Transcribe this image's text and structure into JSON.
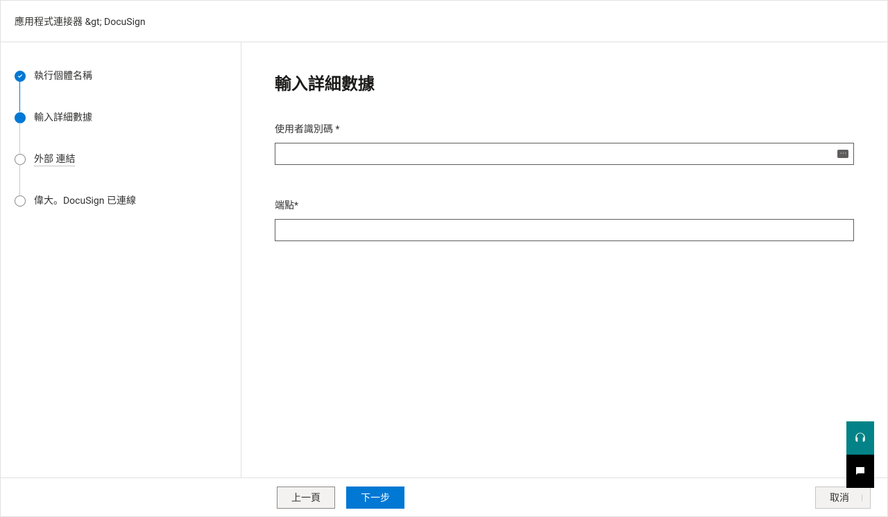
{
  "header": {
    "breadcrumb": "應用程式連接器 &gt;  DocuSign"
  },
  "sidebar": {
    "steps": [
      {
        "label": "執行個體名稱",
        "state": "completed"
      },
      {
        "label": "輸入詳細數據",
        "state": "current"
      },
      {
        "label": "外部   連結",
        "state": "pending"
      },
      {
        "label": "偉大。DocuSign 已連線",
        "state": "pending"
      }
    ]
  },
  "main": {
    "title": "輸入詳細數據",
    "fields": {
      "userId": {
        "label": "使用者識別碼 *",
        "value": ""
      },
      "endpoint": {
        "label": "端點*",
        "value": ""
      }
    }
  },
  "footer": {
    "back": "上一頁",
    "next": "下一步",
    "cancel": "取消"
  },
  "floating": {
    "support_icon": "headset-icon",
    "chat_icon": "chat-icon"
  }
}
